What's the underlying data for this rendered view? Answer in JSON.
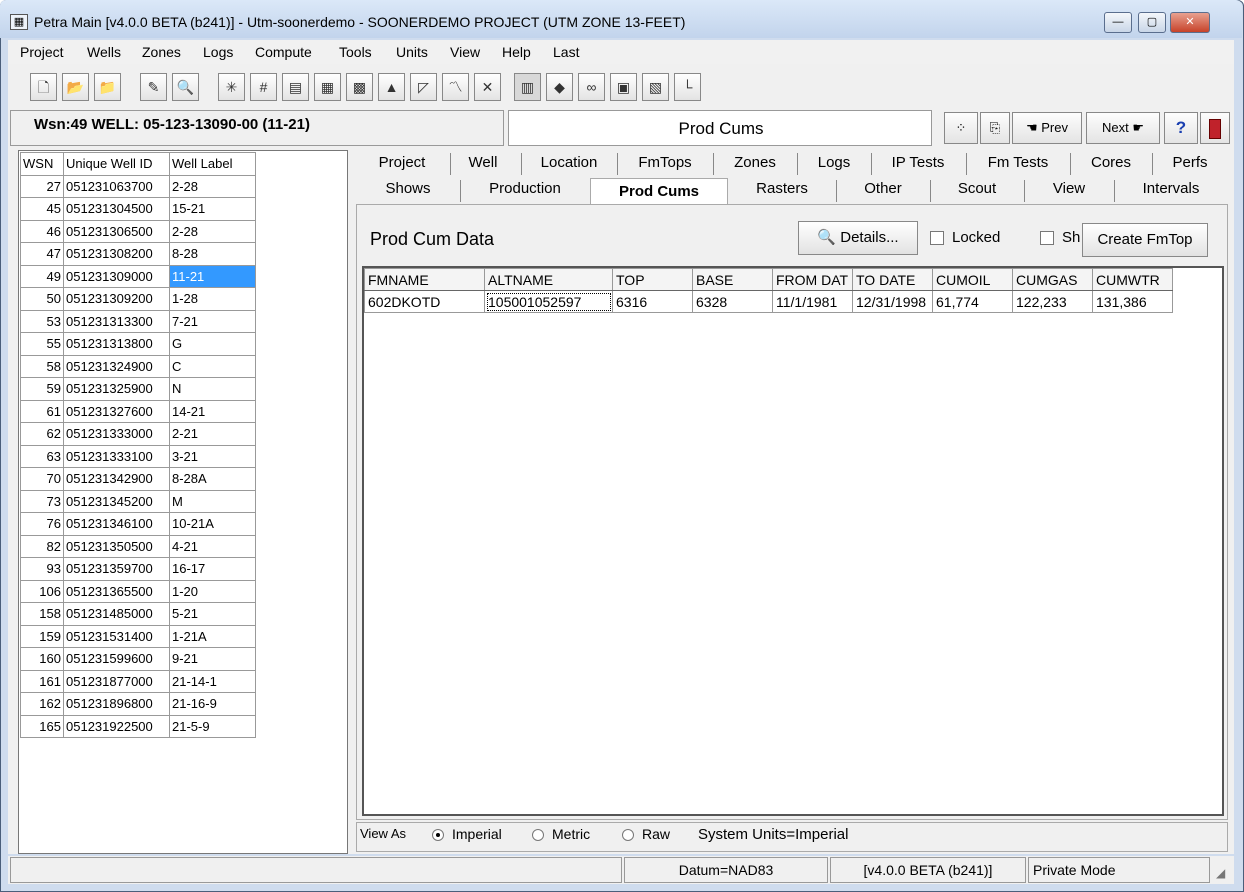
{
  "window": {
    "title": "Petra Main [v4.0.0 BETA (b241)] - Utm-soonerdemo - SOONERDEMO PROJECT (UTM ZONE 13-FEET)"
  },
  "menu": [
    "Project",
    "Wells",
    "Zones",
    "Logs",
    "Compute",
    "Tools",
    "Units",
    "View",
    "Help",
    "Last"
  ],
  "header": {
    "well": "Wsn:49 WELL: 05-123-13090-00 (11-21)",
    "page_title": "Prod Cums",
    "prev_label": "Prev",
    "next_label": "Next",
    "help_label": "?"
  },
  "well_list": {
    "columns": [
      "WSN",
      "Unique Well ID",
      "Well Label"
    ],
    "rows": [
      [
        "27",
        "051231063700",
        "2-28"
      ],
      [
        "45",
        "051231304500",
        "15-21"
      ],
      [
        "46",
        "051231306500",
        "2-28"
      ],
      [
        "47",
        "051231308200",
        "8-28"
      ],
      [
        "49",
        "051231309000",
        "11-21"
      ],
      [
        "50",
        "051231309200",
        "1-28"
      ],
      [
        "53",
        "051231313300",
        "7-21"
      ],
      [
        "55",
        "051231313800",
        "G"
      ],
      [
        "58",
        "051231324900",
        "C"
      ],
      [
        "59",
        "051231325900",
        "N"
      ],
      [
        "61",
        "051231327600",
        "14-21"
      ],
      [
        "62",
        "051231333000",
        "2-21"
      ],
      [
        "63",
        "051231333100",
        "3-21"
      ],
      [
        "70",
        "051231342900",
        "8-28A"
      ],
      [
        "73",
        "051231345200",
        "M"
      ],
      [
        "76",
        "051231346100",
        "10-21A"
      ],
      [
        "82",
        "051231350500",
        "4-21"
      ],
      [
        "93",
        "051231359700",
        "16-17"
      ],
      [
        "106",
        "051231365500",
        "1-20"
      ],
      [
        "158",
        "051231485000",
        "5-21"
      ],
      [
        "159",
        "051231531400",
        "1-21A"
      ],
      [
        "160",
        "051231599600",
        "9-21"
      ],
      [
        "161",
        "051231877000",
        "21-14-1"
      ],
      [
        "162",
        "051231896800",
        "21-16-9"
      ],
      [
        "165",
        "051231922500",
        "21-5-9"
      ]
    ],
    "selected_index": 4
  },
  "tabs_row1": [
    "Project",
    "Well",
    "Location",
    "FmTops",
    "Zones",
    "Logs",
    "IP Tests",
    "Fm Tests",
    "Cores",
    "Perfs"
  ],
  "tabs_row2": [
    "Shows",
    "Production",
    "Prod Cums",
    "Rasters",
    "Other",
    "Scout",
    "View",
    "Intervals"
  ],
  "active_tab": "Prod Cums",
  "section": {
    "title": "Prod Cum Data",
    "details_label": "Details...",
    "locked_label": "Locked",
    "show_label": "Sh",
    "create_label": "Create FmTop"
  },
  "grid": {
    "columns": [
      "FMNAME",
      "ALTNAME",
      "TOP",
      "BASE",
      "FROM DAT",
      "TO DATE",
      "CUMOIL",
      "CUMGAS",
      "CUMWTR"
    ],
    "rows": [
      [
        "602DKOTD",
        "105001052597",
        "6316",
        "6328",
        "11/1/1981",
        "12/31/1998",
        "61,774",
        "122,233",
        "131,386"
      ]
    ]
  },
  "view_as": {
    "label": "View As",
    "options": [
      "Imperial",
      "Metric",
      "Raw"
    ],
    "selected": "Imperial",
    "system_units": "System Units=Imperial"
  },
  "status": {
    "datum": "Datum=NAD83",
    "version": "[v4.0.0 BETA (b241)]",
    "mode": "Private Mode"
  },
  "colors": {
    "selection": "#3399ff",
    "title_gradient_top": "#dbe8f8",
    "close_button": "#c7432a"
  }
}
